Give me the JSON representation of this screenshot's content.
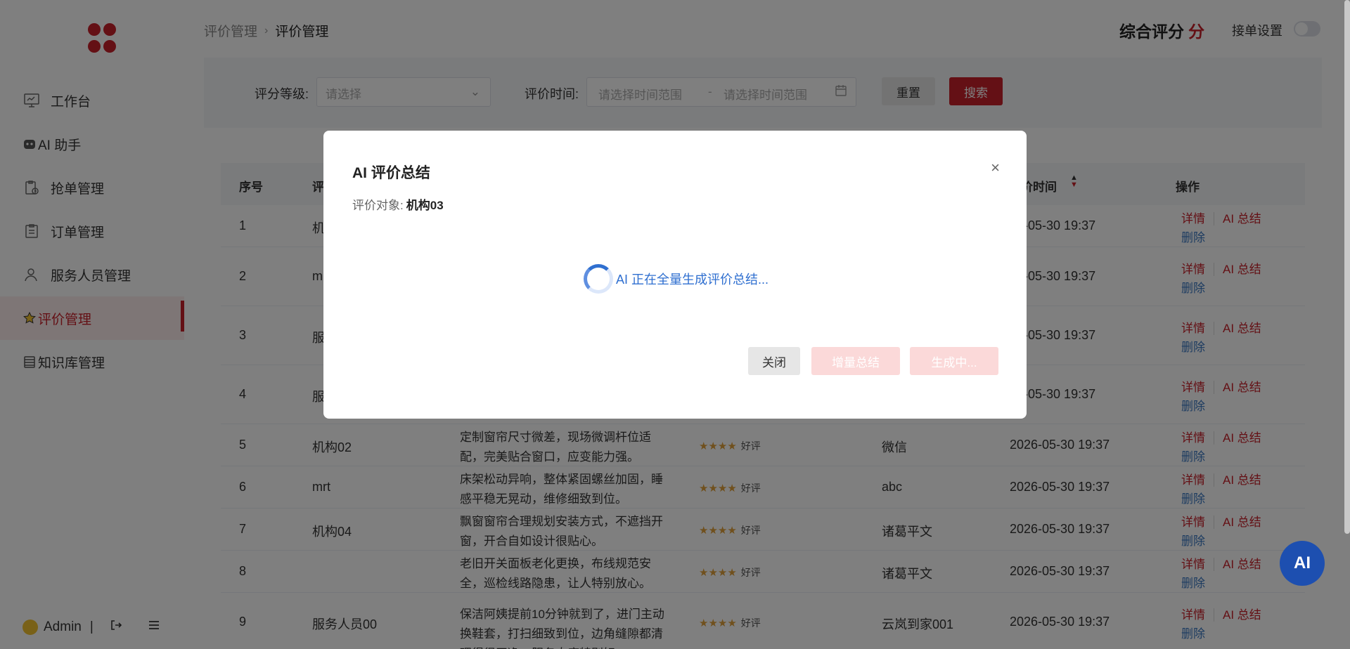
{
  "sidebar": {
    "items": [
      {
        "label": "工作台",
        "icon": "monitor-icon"
      },
      {
        "label": "AI 助手",
        "icon": "ai-bot-icon"
      },
      {
        "label": "抢单管理",
        "icon": "clipboard-clock-icon"
      },
      {
        "label": "订单管理",
        "icon": "clipboard-icon"
      },
      {
        "label": "服务人员管理",
        "icon": "person-icon"
      },
      {
        "label": "评价管理",
        "icon": "star-icon"
      },
      {
        "label": "知识库管理",
        "icon": "book-icon"
      }
    ],
    "user": {
      "name": "Admin",
      "separator": "|"
    }
  },
  "header": {
    "breadcrumb": [
      "评价管理",
      "评价管理"
    ],
    "score_label": "综合评分",
    "score_unit": "分",
    "accept_label": "接单设置"
  },
  "filter": {
    "grade_label": "评分等级:",
    "grade_placeholder": "请选择",
    "time_label": "评价时间:",
    "time_start_placeholder": "请选择时间范围",
    "time_sep": "-",
    "time_end_placeholder": "请选择时间范围",
    "reset_label": "重置",
    "search_label": "搜索"
  },
  "table": {
    "headers": {
      "no": "序号",
      "name": "评",
      "time": "价时间",
      "ops": "操作"
    },
    "op_labels": {
      "detail": "详情",
      "ai": "AI 总结",
      "delete": "删除"
    },
    "rows": [
      {
        "no": "1",
        "name": "机",
        "content": "",
        "stars": "",
        "grade": "",
        "user": "",
        "time": "26-05-30 19:37"
      },
      {
        "no": "2",
        "name": "m",
        "content": "",
        "stars": "",
        "grade": "",
        "user": "",
        "time": "26-05-30 19:37"
      },
      {
        "no": "3",
        "name": "服",
        "content": "",
        "stars": "",
        "grade": "",
        "user": "",
        "time": "26-05-30 19:37"
      },
      {
        "no": "4",
        "name": "服",
        "content": "",
        "stars": "",
        "grade": "",
        "user": "",
        "time": "26-05-30 19:37"
      },
      {
        "no": "5",
        "name": "机构02",
        "content": "定制窗帘尺寸微差，现场微调杆位适配，完美贴合窗口，应变能力强。",
        "stars": "★★★★",
        "grade": "好评",
        "user": "微信",
        "time": "2026-05-30 19:37"
      },
      {
        "no": "6",
        "name": "mrt",
        "content": "床架松动异响，整体紧固螺丝加固，睡感平稳无晃动，维修细致到位。",
        "stars": "★★★★",
        "grade": "好评",
        "user": "abc",
        "time": "2026-05-30 19:37"
      },
      {
        "no": "7",
        "name": "机构04",
        "content": "飘窗窗帘合理规划安装方式，不遮挡开窗，开合自如设计很贴心。",
        "stars": "★★★★",
        "grade": "好评",
        "user": "诸葛平文",
        "time": "2026-05-30 19:37"
      },
      {
        "no": "8",
        "name": "",
        "content": "老旧开关面板老化更换，布线规范安全，巡检线路隐患，让人特别放心。",
        "stars": "★★★★",
        "grade": "好评",
        "user": "诸葛平文",
        "time": "2026-05-30 19:37"
      },
      {
        "no": "9",
        "name": "服务人员00",
        "content": "保洁阿姨提前10分钟就到了，进门主动换鞋套，打扫细致到位，边角缝隙都清理得很干净，服务态度特别好。",
        "stars": "★★★★",
        "grade": "好评",
        "user": "云岚到家001",
        "time": "2026-05-30 19:37"
      }
    ]
  },
  "modal": {
    "title": "AI 评价总结",
    "target_label": "评价对象:",
    "target_value": "机构03",
    "loading_text": "AI 正在全量生成评价总结...",
    "close_label": "关闭",
    "incremental_label": "增量总结",
    "generating_label": "生成中..."
  },
  "fab": {
    "label": "AI"
  },
  "colors": {
    "brand": "#c8202a",
    "link": "#3a78c2",
    "fab": "#1d4fb0"
  }
}
